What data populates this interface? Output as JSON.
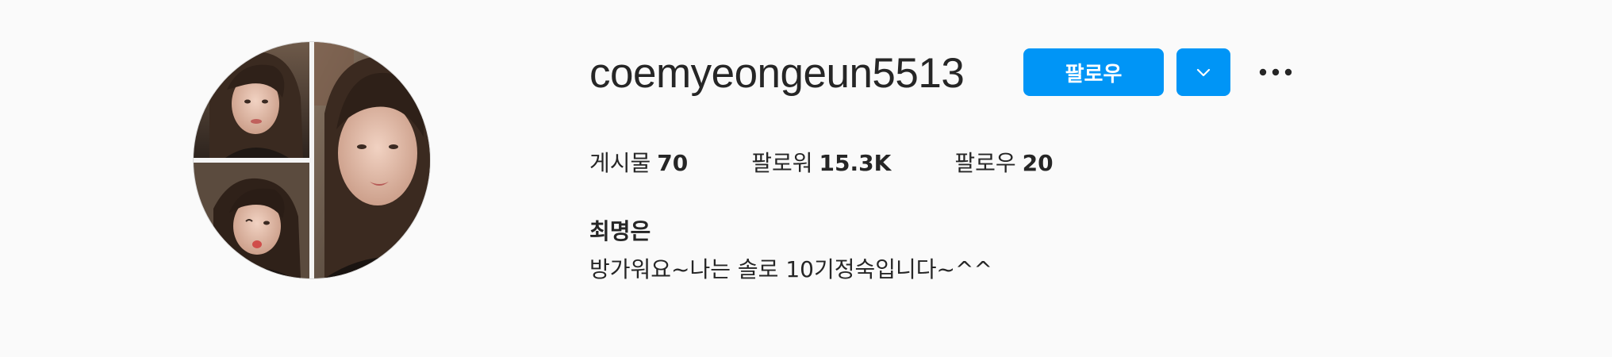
{
  "profile": {
    "username": "coemyeongeun5513",
    "full_name": "최명은",
    "bio": "방가워요~나는 솔로 10기정숙입니다~^^",
    "avatar_icon": "profile-photo-collage"
  },
  "actions": {
    "follow_label": "팔로우",
    "dropdown_icon": "chevron-down-icon",
    "more_icon": "more-options-icon"
  },
  "stats": [
    {
      "label": "게시물",
      "value": "70"
    },
    {
      "label": "팔로워",
      "value": "15.3K"
    },
    {
      "label": "팔로우",
      "value": "20"
    }
  ],
  "colors": {
    "accent": "#0095f6",
    "text": "#262626",
    "background": "#fafafa"
  }
}
